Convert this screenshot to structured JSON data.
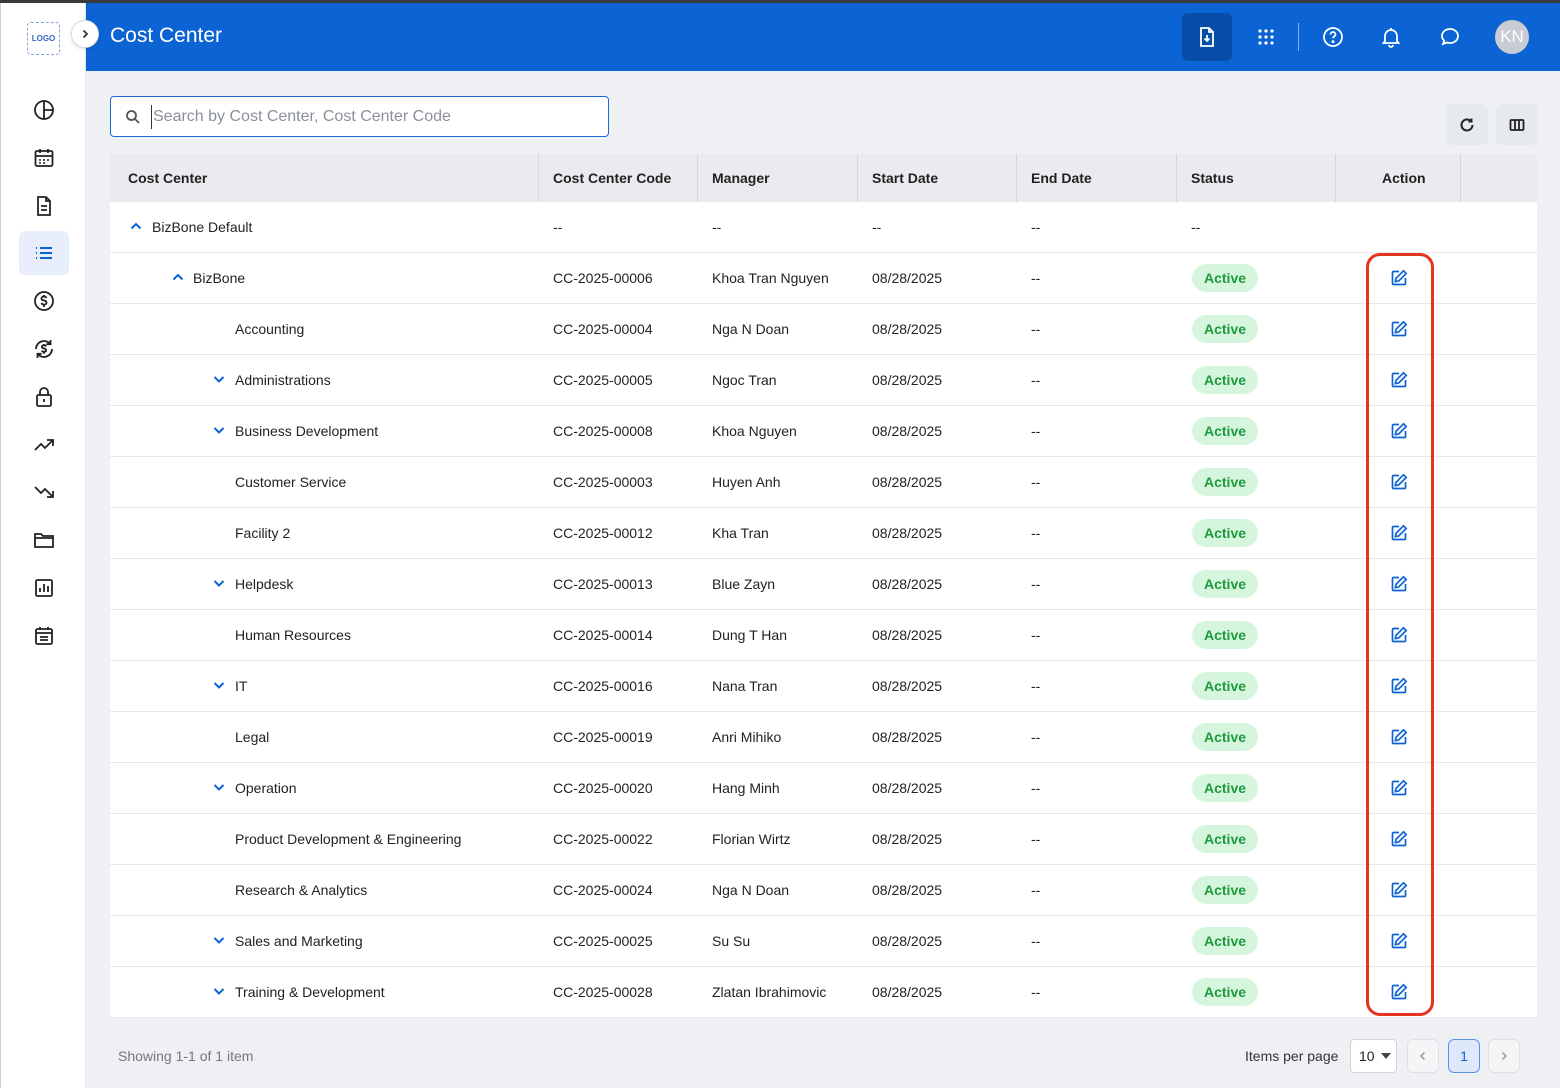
{
  "app": {
    "logo_text": "LOGO",
    "title": "Cost Center",
    "avatar_initials": "KN"
  },
  "sidebar": {
    "items": [
      {
        "icon": "chart-pie-icon"
      },
      {
        "icon": "calendar-icon"
      },
      {
        "icon": "document-icon"
      },
      {
        "icon": "list-icon",
        "active": true
      },
      {
        "icon": "dollar-icon"
      },
      {
        "icon": "currency-sync-icon"
      },
      {
        "icon": "lock-icon"
      },
      {
        "icon": "trending-up-icon"
      },
      {
        "icon": "trending-down-icon"
      },
      {
        "icon": "folder-icon"
      },
      {
        "icon": "bar-chart-icon"
      },
      {
        "icon": "calendar-list-icon"
      }
    ]
  },
  "search": {
    "placeholder": "Search by Cost Center, Cost Center Code",
    "value": ""
  },
  "table": {
    "columns": [
      "Cost Center",
      "Cost Center Code",
      "Manager",
      "Start Date",
      "End Date",
      "Status",
      "Action"
    ],
    "rows": [
      {
        "name": "BizBone Default",
        "level": 0,
        "toggle": "up",
        "code": "--",
        "manager": "--",
        "start": "--",
        "end": "--",
        "status": "--",
        "action": false
      },
      {
        "name": "BizBone",
        "level": 1,
        "toggle": "up",
        "code": "CC-2025-00006",
        "manager": "Khoa Tran Nguyen",
        "start": "08/28/2025",
        "end": "--",
        "status": "Active",
        "action": true
      },
      {
        "name": "Accounting",
        "level": 2,
        "toggle": "none",
        "code": "CC-2025-00004",
        "manager": "Nga N Doan",
        "start": "08/28/2025",
        "end": "--",
        "status": "Active",
        "action": true
      },
      {
        "name": "Administrations",
        "level": 2,
        "toggle": "down",
        "code": "CC-2025-00005",
        "manager": "Ngoc Tran",
        "start": "08/28/2025",
        "end": "--",
        "status": "Active",
        "action": true
      },
      {
        "name": "Business Development",
        "level": 2,
        "toggle": "down",
        "code": "CC-2025-00008",
        "manager": "Khoa Nguyen",
        "start": "08/28/2025",
        "end": "--",
        "status": "Active",
        "action": true
      },
      {
        "name": "Customer Service",
        "level": 2,
        "toggle": "none",
        "code": "CC-2025-00003",
        "manager": "Huyen Anh",
        "start": "08/28/2025",
        "end": "--",
        "status": "Active",
        "action": true
      },
      {
        "name": "Facility 2",
        "level": 2,
        "toggle": "none",
        "code": "CC-2025-00012",
        "manager": "Kha Tran",
        "start": "08/28/2025",
        "end": "--",
        "status": "Active",
        "action": true
      },
      {
        "name": "Helpdesk",
        "level": 2,
        "toggle": "down",
        "code": "CC-2025-00013",
        "manager": "Blue Zayn",
        "start": "08/28/2025",
        "end": "--",
        "status": "Active",
        "action": true
      },
      {
        "name": "Human Resources",
        "level": 2,
        "toggle": "none",
        "code": "CC-2025-00014",
        "manager": "Dung T Han",
        "start": "08/28/2025",
        "end": "--",
        "status": "Active",
        "action": true
      },
      {
        "name": "IT",
        "level": 2,
        "toggle": "down",
        "code": "CC-2025-00016",
        "manager": "Nana Tran",
        "start": "08/28/2025",
        "end": "--",
        "status": "Active",
        "action": true
      },
      {
        "name": "Legal",
        "level": 2,
        "toggle": "none",
        "code": "CC-2025-00019",
        "manager": "Anri Mihiko",
        "start": "08/28/2025",
        "end": "--",
        "status": "Active",
        "action": true
      },
      {
        "name": "Operation",
        "level": 2,
        "toggle": "down",
        "code": "CC-2025-00020",
        "manager": "Hang Minh",
        "start": "08/28/2025",
        "end": "--",
        "status": "Active",
        "action": true
      },
      {
        "name": "Product Development & Engineering",
        "level": 2,
        "toggle": "none",
        "code": "CC-2025-00022",
        "manager": "Florian Wirtz",
        "start": "08/28/2025",
        "end": "--",
        "status": "Active",
        "action": true
      },
      {
        "name": "Research & Analytics",
        "level": 2,
        "toggle": "none",
        "code": "CC-2025-00024",
        "manager": "Nga N Doan",
        "start": "08/28/2025",
        "end": "--",
        "status": "Active",
        "action": true
      },
      {
        "name": "Sales and Marketing",
        "level": 2,
        "toggle": "down",
        "code": "CC-2025-00025",
        "manager": "Su Su",
        "start": "08/28/2025",
        "end": "--",
        "status": "Active",
        "action": true
      },
      {
        "name": "Training & Development",
        "level": 2,
        "toggle": "down",
        "code": "CC-2025-00028",
        "manager": "Zlatan Ibrahimovic",
        "start": "08/28/2025",
        "end": "--",
        "status": "Active",
        "action": true
      }
    ]
  },
  "footer": {
    "showing": "Showing 1-1 of 1 item",
    "items_per_page_label": "Items per page",
    "items_per_page": "10",
    "current_page": "1"
  },
  "colors": {
    "primary": "#0c63d4",
    "status_active_bg": "#d6f5dd",
    "status_active_text": "#1e9a3e",
    "highlight": "#e53322"
  }
}
